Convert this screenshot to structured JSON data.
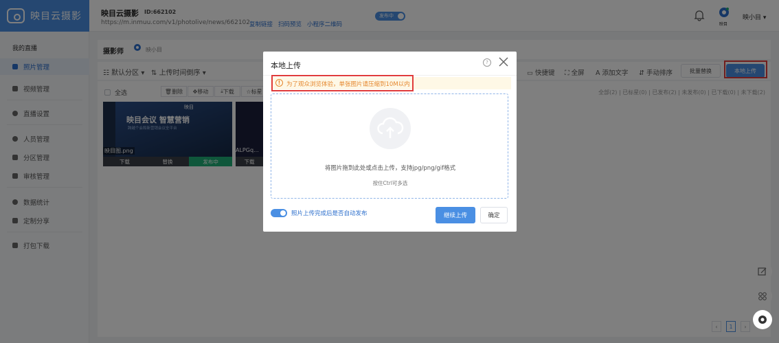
{
  "app": {
    "logo_text": "映目云摄影"
  },
  "header": {
    "title": "映目云摄影",
    "id_label": "ID:662102",
    "url": "https://m.inmuu.com/v1/photolive/news/662102",
    "links": [
      "复制链接",
      "扫码预览",
      "小程序二维码"
    ],
    "publish_toggle": "发布中",
    "user_name": "映小目 ▾",
    "avatar_caption": "映目"
  },
  "sidebar": {
    "section": "我的直播",
    "items": [
      {
        "label": "照片管理",
        "active": true
      },
      {
        "label": "视频管理"
      },
      {
        "label": "直播设置"
      },
      {
        "label": "人员管理"
      },
      {
        "label": "分区管理"
      },
      {
        "label": "审核管理"
      },
      {
        "label": "数据统计"
      },
      {
        "label": "定制分享"
      },
      {
        "label": "打包下载"
      }
    ]
  },
  "main": {
    "photographer_label": "摄影师",
    "photographer_name": "映小目",
    "toolbar": {
      "partition": "默认分区 ▾",
      "sort": "上传时间倒序 ▾",
      "shortcuts": "快捷键",
      "fullscreen": "全屏",
      "add_text": "添加文字",
      "manual_sort": "手动排序",
      "batch_replace": "批量替换",
      "local_upload": "本地上传"
    },
    "select_all": "全选",
    "actions": [
      "删除",
      "移动",
      "下载",
      "标星"
    ],
    "filters": "全部(2)  |  已标星(0)  |  已发布(2)  |  未发布(0)  |  已下载(0)  |  未下载(2)",
    "cards": [
      {
        "title": "映目会议 智慧营销",
        "subtitle": "跨越个会和新营销会议全平台",
        "logo": "映目",
        "filename": "映目图.png",
        "actions": [
          "下载",
          "替换",
          "发布中"
        ]
      },
      {
        "filename": "ALPGq...",
        "actions": [
          "下载"
        ]
      }
    ]
  },
  "modal": {
    "title": "本地上传",
    "warning": "为了观众浏览体验，单张图片请压缩到10M以内",
    "drop_text": "将图片拖到此处或点击上传，支持jpg/png/gif格式",
    "drop_sub": "按住Ctrl可多选",
    "auto_publish_label": "照片上传完成后是否自动发布",
    "continue_button": "继续上传",
    "confirm_button": "确定"
  },
  "pager": {
    "current": "1"
  },
  "colors": {
    "primary": "#4a8fe3",
    "warning": "#e5862d",
    "highlight": "#e03b3b",
    "published": "#1fae76"
  }
}
